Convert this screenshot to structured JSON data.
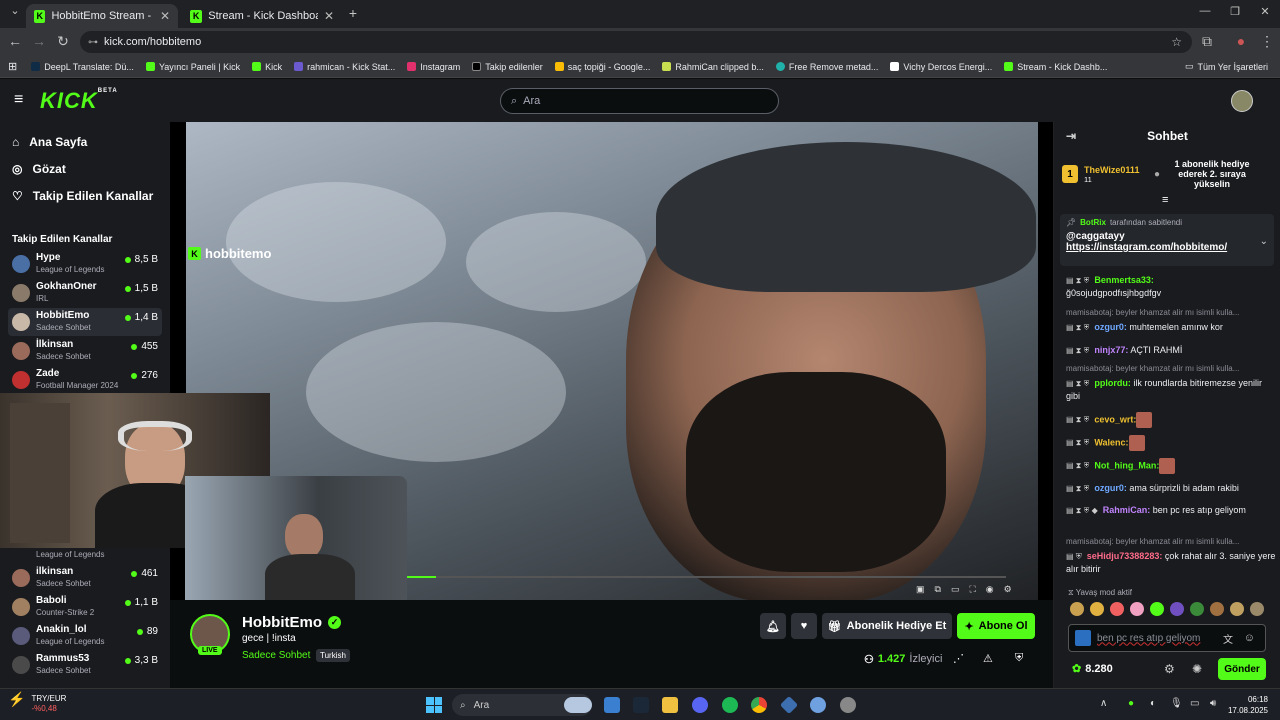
{
  "browser": {
    "tabs": [
      {
        "title": "HobbitEmo Stream - Watch Live",
        "active": true
      },
      {
        "title": "Stream - Kick Dashboard",
        "active": false
      }
    ],
    "url": "kick.com/hobbitemo",
    "bookmarks": [
      "DeepL Translate: Dü...",
      "Yayıncı Paneli | Kick",
      "Kick",
      "rahmican - Kick Stat...",
      "Instagram",
      "Takip edilenler",
      "saç topiği - Google...",
      "RahmiCan clipped b...",
      "Free Remove metad...",
      "Vichy Dercos Energi...",
      "Stream - Kick Dashb..."
    ],
    "all_bookmarks": "Tüm Yer İşaretleri"
  },
  "header": {
    "logo": "KICK",
    "logo_badge": "BETA",
    "search_placeholder": "Ara"
  },
  "sidebar": {
    "nav": [
      {
        "label": "Ana Sayfa",
        "icon": "home-icon"
      },
      {
        "label": "Gözat",
        "icon": "compass-icon"
      },
      {
        "label": "Takip Edilen Kanallar",
        "icon": "heart-icon"
      }
    ],
    "section_title": "Takip Edilen Kanallar",
    "channels_top": [
      {
        "name": "Hype",
        "category": "League of Legends",
        "viewers": "8,5 B"
      },
      {
        "name": "GokhanOner",
        "category": "IRL",
        "viewers": "1,5 B"
      },
      {
        "name": "HobbitEmo",
        "category": "Sadece Sohbet",
        "viewers": "1,4 B"
      },
      {
        "name": "İlkinsan",
        "category": "Sadece Sohbet",
        "viewers": "455"
      },
      {
        "name": "Zade",
        "category": "Football Manager 2024",
        "viewers": "276"
      }
    ],
    "channels_bottom": [
      {
        "name": "",
        "category": "League of Legends",
        "viewers": ""
      },
      {
        "name": "ilkinsan",
        "category": "Sadece Sohbet",
        "viewers": "461"
      },
      {
        "name": "Baboli",
        "category": "Counter-Strike 2",
        "viewers": "1,1 B"
      },
      {
        "name": "Anakin_lol",
        "category": "League of Legends",
        "viewers": "89"
      },
      {
        "name": "Rammus53",
        "category": "Sadece Sohbet",
        "viewers": "3,3 B"
      }
    ]
  },
  "video": {
    "watermark": "hobbitemo",
    "progress": 0.05
  },
  "stream": {
    "name": "HobbitEmo",
    "title": "gece | !insta",
    "category": "Sadece Sohbet",
    "language": "Turkish",
    "live": "LIVE",
    "gift_label": "Abonelik Hediye Et",
    "subscribe_label": "Abone Ol",
    "viewers": "1.427",
    "viewers_label": "İzleyici"
  },
  "chat": {
    "title": "Sohbet",
    "gift": {
      "rank": "1",
      "user": "TheWize0111",
      "count": "11",
      "message": "1 abonelik hediye ederek 2. sıraya yükselin"
    },
    "pinned": {
      "user": "BotRix",
      "by": "tarafından sabitlendi",
      "mention": "@caggatayy",
      "link": "https://instagram.com/hobbitemo/"
    },
    "messages": [
      {
        "reply": "",
        "user": "Benmertsa33:",
        "color": "#53fc18",
        "text": "ğ0sojudgpodfısjhbgdfgv"
      },
      {
        "reply": "mamisabotaj: beyler khamzat alir mı isimli kulla...",
        "user": "ozgur0:",
        "color": "#6fa8ff",
        "text": "muhtemelen amınw kor"
      },
      {
        "reply": "",
        "user": "ninjx77:",
        "color": "#c084fc",
        "text": "AÇTI RAHMİ"
      },
      {
        "reply": "mamisabotaj: beyler khamzat alir mı isimli kulla...",
        "user": "pplordu:",
        "color": "#53fc18",
        "text": "ilk roundlarda bitiremezse yenilir gibi"
      },
      {
        "reply": "",
        "user": "cevo_wrt:",
        "color": "#f0c030",
        "text": ""
      },
      {
        "reply": "",
        "user": "Walenc:",
        "color": "#f0c030",
        "text": ""
      },
      {
        "reply": "",
        "user": "Not_hing_Man:",
        "color": "#53fc18",
        "text": ""
      },
      {
        "reply": "",
        "user": "ozgur0:",
        "color": "#6fa8ff",
        "text": "ama sürprizli bi adam rakibi"
      },
      {
        "reply": "",
        "user": "RahmiCan:",
        "color": "#c084fc",
        "text": "ben pc res atıp geliyom"
      },
      {
        "reply": "mamisabotaj: beyler khamzat alir mı isimli kulla...",
        "user": "seHidju73388283:",
        "color": "#ff6b8a",
        "text": "çok rahat alır 3. saniye yere alır bitirir"
      }
    ],
    "slow_mode": "Yavaş mod aktif",
    "input_value": "ben pc res atıp geliyom",
    "points": "8.280",
    "send_label": "Gönder"
  },
  "taskbar": {
    "currency": "TRY/EUR",
    "currency_change": "-%0,48",
    "search_placeholder": "Ara",
    "time": "06:18",
    "date": "17.08.2025"
  },
  "colors": {
    "accent": "#53fc18",
    "bg": "#0b0e0f",
    "panel": "#191b1f"
  }
}
